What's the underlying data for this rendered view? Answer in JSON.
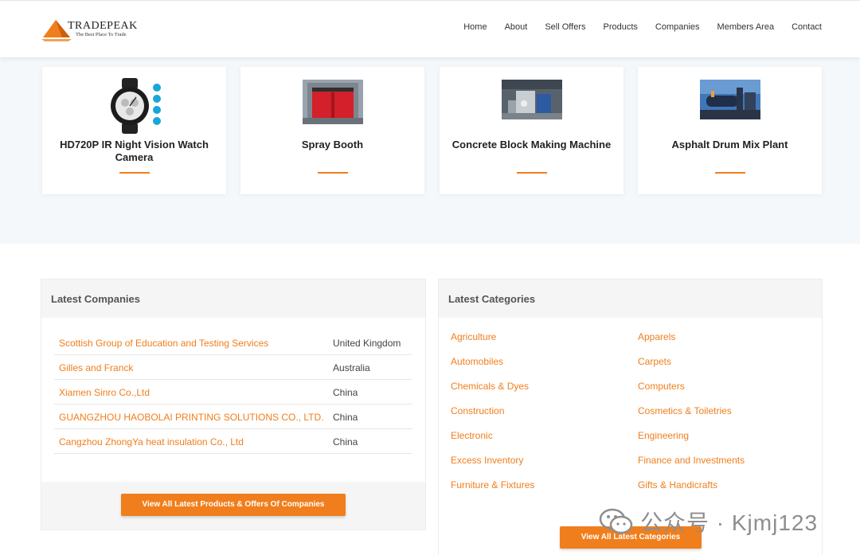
{
  "brand": {
    "name": "TRADEPEAK",
    "tagline": "The Best Place To Trade",
    "accent": "#f07e1c"
  },
  "nav": [
    "Home",
    "About",
    "Sell Offers",
    "Products",
    "Companies",
    "Members Area",
    "Contact"
  ],
  "products": [
    {
      "title": "HD720P IR Night Vision Watch Camera",
      "image": "watch-camera-image"
    },
    {
      "title": "Spray Booth",
      "image": "spray-booth-image"
    },
    {
      "title": "Concrete Block Making Machine",
      "image": "block-machine-image"
    },
    {
      "title": "Asphalt Drum Mix Plant",
      "image": "asphalt-plant-image"
    }
  ],
  "latest_companies": {
    "heading": "Latest Companies",
    "rows": [
      {
        "name": "Scottish Group of Education and Testing Services",
        "country": "United Kingdom"
      },
      {
        "name": "Gilles and Franck",
        "country": "Australia"
      },
      {
        "name": "Xiamen Sinro Co.,Ltd",
        "country": "China"
      },
      {
        "name": "GUANGZHOU HAOBOLAI PRINTING SOLUTIONS CO., LTD.",
        "country": "China"
      },
      {
        "name": "Cangzhou ZhongYa heat insulation Co., Ltd",
        "country": "China"
      }
    ],
    "button": "View All Latest Products & Offers Of Companies"
  },
  "latest_categories": {
    "heading": "Latest Categories",
    "left": [
      "Agriculture",
      "Automobiles",
      "Chemicals & Dyes",
      "Construction",
      "Electronic",
      "Excess Inventory",
      "Furniture & Fixtures"
    ],
    "right": [
      "Apparels",
      "Carpets",
      "Computers",
      "Cosmetics & Toiletries",
      "Engineering",
      "Finance and Investments",
      "Gifts & Handicrafts"
    ],
    "button": "View All Latest Categories"
  },
  "watermark": {
    "text": "公众号 · Kjmj123",
    "icon": "wechat-icon"
  }
}
